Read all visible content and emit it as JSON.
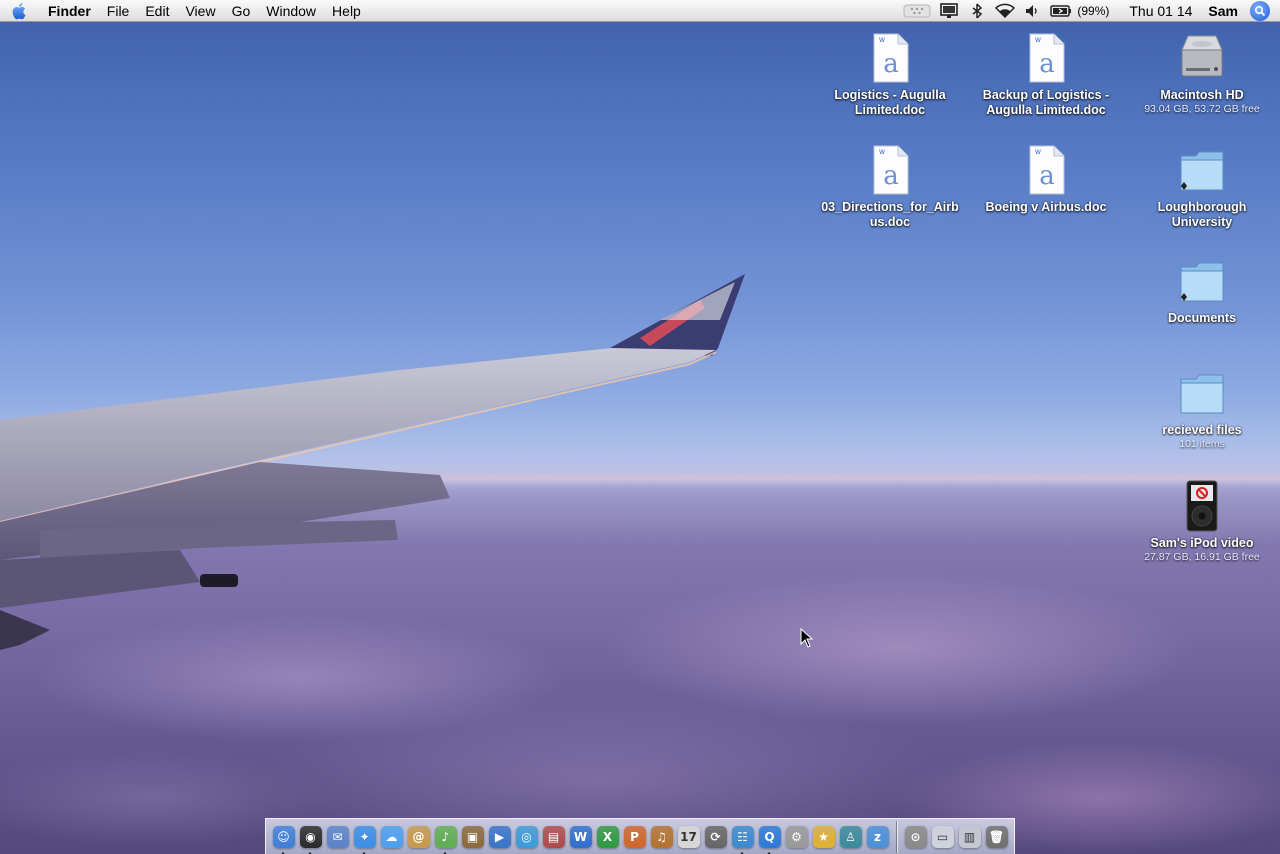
{
  "menubar": {
    "app_name": "Finder",
    "menus": [
      "File",
      "Edit",
      "View",
      "Go",
      "Window",
      "Help"
    ],
    "battery_text": "(99%)",
    "clock": "Thu 01 14",
    "user": "Sam",
    "status_icons": [
      "menu-extra-icon",
      "display-icon",
      "bluetooth-icon",
      "wifi-icon",
      "volume-icon",
      "battery-icon",
      "spotlight-icon"
    ]
  },
  "desktop": {
    "icons": [
      {
        "label": "Logistics - Augulla Limited.doc",
        "sub": "",
        "icon": "word-document-icon"
      },
      {
        "label": "Backup of Logistics - Augulla Limited.doc",
        "sub": "",
        "icon": "word-document-icon"
      },
      {
        "label": "Macintosh HD",
        "sub": "93.04 GB, 53.72 GB free",
        "icon": "hard-drive-icon"
      },
      {
        "label": "03_Directions_for_Airbus.doc",
        "sub": "",
        "icon": "word-document-icon"
      },
      {
        "label": "Boeing v Airbus.doc",
        "sub": "",
        "icon": "word-document-icon"
      },
      {
        "label": "Loughborough University",
        "sub": "",
        "icon": "folder-alias-icon"
      },
      {
        "label": "Documents",
        "sub": "",
        "icon": "folder-alias-icon"
      },
      {
        "label": "recieved files",
        "sub": "101 items",
        "icon": "folder-icon"
      },
      {
        "label": "Sam's iPod video",
        "sub": "27.87 GB, 16.91 GB free",
        "icon": "ipod-icon"
      }
    ]
  },
  "dock": {
    "apps": [
      {
        "name": "finder-icon",
        "glyph": "☺",
        "color": "#3f7fd8",
        "running": true
      },
      {
        "name": "dashboard-icon",
        "glyph": "◉",
        "color": "#2a2a2a",
        "running": true
      },
      {
        "name": "mail-icon",
        "glyph": "✉",
        "color": "#5b83c9",
        "running": false
      },
      {
        "name": "safari-icon",
        "glyph": "✦",
        "color": "#3b8ee6",
        "running": true
      },
      {
        "name": "ichat-icon",
        "glyph": "☁",
        "color": "#4aa0f0",
        "running": false
      },
      {
        "name": "address-book-icon",
        "glyph": "@",
        "color": "#c79a4a",
        "running": false
      },
      {
        "name": "itunes-icon",
        "glyph": "♪",
        "color": "#5fae52",
        "running": true
      },
      {
        "name": "iphoto-icon",
        "glyph": "▣",
        "color": "#8b6a3a",
        "running": false
      },
      {
        "name": "imovie-icon",
        "glyph": "▶",
        "color": "#3874c8",
        "running": false
      },
      {
        "name": "idvd-icon",
        "glyph": "◎",
        "color": "#3c9bd8",
        "running": false
      },
      {
        "name": "preview-icon",
        "glyph": "▤",
        "color": "#b04a4a",
        "running": false
      },
      {
        "name": "word-icon",
        "glyph": "W",
        "color": "#2f6fcf",
        "running": false
      },
      {
        "name": "excel-icon",
        "glyph": "X",
        "color": "#2f9a3f",
        "running": false
      },
      {
        "name": "powerpoint-icon",
        "glyph": "P",
        "color": "#d0662a",
        "running": false
      },
      {
        "name": "garageband-icon",
        "glyph": "♫",
        "color": "#b4722c",
        "running": false
      },
      {
        "name": "ical-icon",
        "glyph": "17",
        "color": "#d8d8d8",
        "running": false
      },
      {
        "name": "time-machine-icon",
        "glyph": "⟳",
        "color": "#666666",
        "running": false
      },
      {
        "name": "network-icon",
        "glyph": "☷",
        "color": "#3a8ad0",
        "running": true
      },
      {
        "name": "quicktime-icon",
        "glyph": "Q",
        "color": "#2c7ad6",
        "running": true
      },
      {
        "name": "system-preferences-icon",
        "glyph": "⚙",
        "color": "#9a9a9a",
        "running": false
      },
      {
        "name": "sherlock-icon",
        "glyph": "★",
        "color": "#e0b030",
        "running": false
      },
      {
        "name": "automator-icon",
        "glyph": "♙",
        "color": "#3a8a9a",
        "running": false
      },
      {
        "name": "sleep-icon",
        "glyph": "z",
        "color": "#4a90d8",
        "running": false
      }
    ],
    "docs": [
      {
        "name": "downloads-stack-icon",
        "glyph": "⊙",
        "color": "#8a8a8a"
      },
      {
        "name": "keyboard-icon",
        "glyph": "▭",
        "color": "#d0d4dc"
      },
      {
        "name": "hardware-icon",
        "glyph": "▥",
        "color": "#c4c8d0"
      },
      {
        "name": "trash-icon",
        "glyph": "🗑",
        "color": "#707070"
      }
    ]
  }
}
